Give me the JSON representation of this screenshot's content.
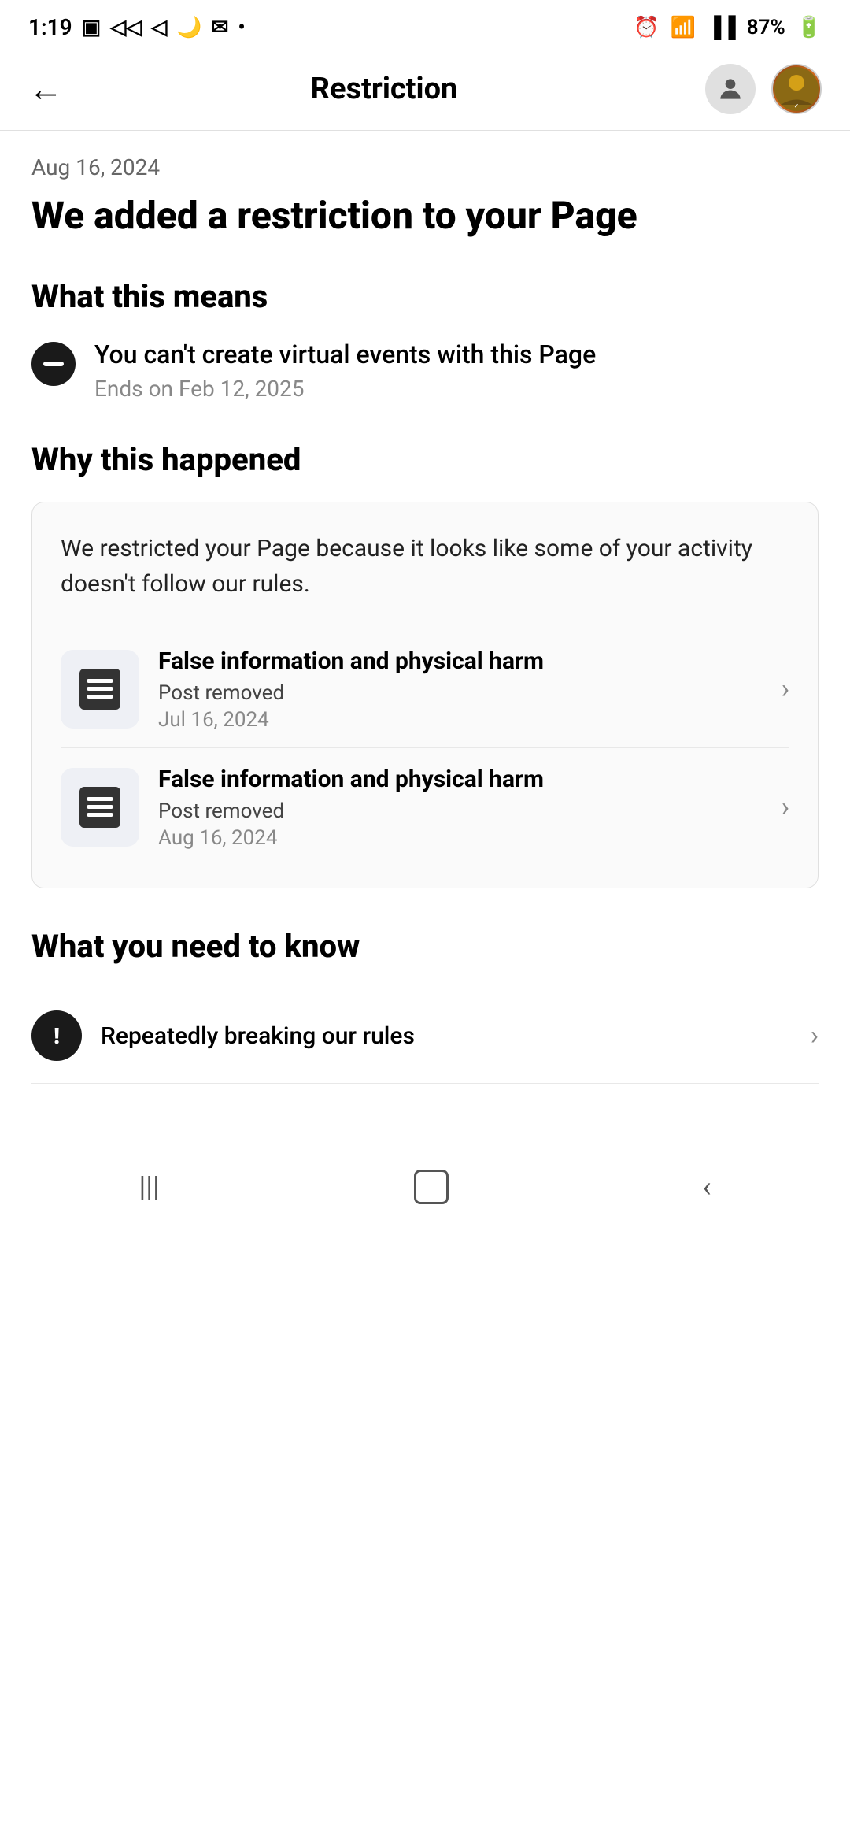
{
  "statusBar": {
    "time": "1:19",
    "battery": "87%"
  },
  "navBar": {
    "title": "Restriction",
    "backArrow": "←"
  },
  "content": {
    "date": "Aug 16, 2024",
    "mainHeading": "We added a restriction to your Page",
    "whatThisMeans": {
      "heading": "What this means",
      "restrictionText": "You can't create virtual events with this Page",
      "endDate": "Ends on Feb 12, 2025"
    },
    "whyThisHappened": {
      "heading": "Why this happened",
      "description": "We restricted your Page because it looks like some of your activity doesn't follow our rules.",
      "items": [
        {
          "title": "False information and physical harm",
          "status": "Post removed",
          "date": "Jul 16, 2024"
        },
        {
          "title": "False information and physical harm",
          "status": "Post removed",
          "date": "Aug 16, 2024"
        }
      ]
    },
    "whatYouNeedToKnow": {
      "heading": "What you need to know",
      "items": [
        {
          "text": "Repeatedly breaking our rules"
        }
      ]
    }
  }
}
